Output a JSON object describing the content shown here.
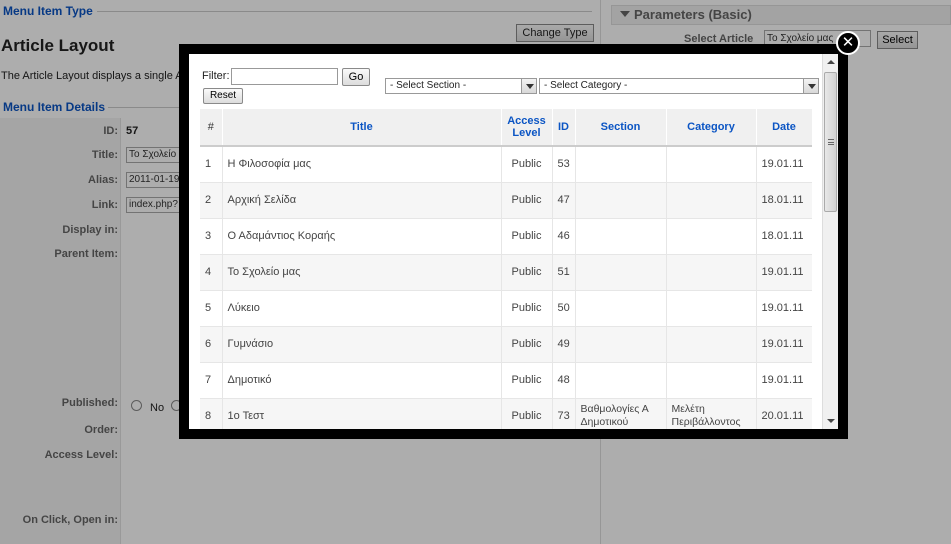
{
  "background": {
    "menu_item_type_legend": "Menu Item Type",
    "article_title": "Article Layout",
    "article_desc": "The Article Layout displays a single A",
    "change_type_button": "Change Type",
    "menu_item_details_legend": "Menu Item Details",
    "fields": {
      "id_label": "ID:",
      "id_value": "57",
      "title_label": "Title:",
      "title_value": "Το Σχολείο",
      "alias_label": "Alias:",
      "alias_value": "2011-01-19",
      "link_label": "Link:",
      "link_value": "index.php?",
      "display_in_label": "Display in:",
      "parent_item_label": "Parent Item:",
      "published_label": "Published:",
      "published_no": "No",
      "order_label": "Order:",
      "access_level_label": "Access Level:",
      "on_click_label": "On Click, Open in:"
    },
    "parameters_title": "Parameters (Basic)",
    "select_article_label": "Select Article",
    "select_article_value": "Το Σχολείο μας",
    "select_button": "Select"
  },
  "modal": {
    "close_glyph": "✕",
    "filter_label": "Filter:",
    "filter_value": "",
    "go_button": "Go",
    "reset_button": "Reset",
    "section_select": "- Select Section -",
    "category_select": "- Select Category -",
    "columns": {
      "num": "#",
      "title": "Title",
      "access_line1": "Access",
      "access_line2": "Level",
      "id": "ID",
      "section": "Section",
      "category": "Category",
      "date": "Date"
    },
    "rows": [
      {
        "num": "1",
        "title": "Η Φιλοσοφία μας",
        "access": "Public",
        "id": "53",
        "section": "",
        "category": "",
        "date": "19.01.11"
      },
      {
        "num": "2",
        "title": "Αρχική Σελίδα",
        "access": "Public",
        "id": "47",
        "section": "",
        "category": "",
        "date": "18.01.11"
      },
      {
        "num": "3",
        "title": "Ο Αδαμάντιος Κοραής",
        "access": "Public",
        "id": "46",
        "section": "",
        "category": "",
        "date": "18.01.11"
      },
      {
        "num": "4",
        "title": "Το Σχολείο μας",
        "access": "Public",
        "id": "51",
        "section": "",
        "category": "",
        "date": "19.01.11"
      },
      {
        "num": "5",
        "title": "Λύκειο",
        "access": "Public",
        "id": "50",
        "section": "",
        "category": "",
        "date": "19.01.11"
      },
      {
        "num": "6",
        "title": "Γυμνάσιο",
        "access": "Public",
        "id": "49",
        "section": "",
        "category": "",
        "date": "19.01.11"
      },
      {
        "num": "7",
        "title": "Δημοτικό",
        "access": "Public",
        "id": "48",
        "section": "",
        "category": "",
        "date": "19.01.11"
      },
      {
        "num": "8",
        "title": "1ο Τεστ",
        "access": "Public",
        "id": "73",
        "section": "Βαθμολογίες Α Δημοτικού",
        "category": "Μελέτη Περιβάλλοντος",
        "date": "20.01.11"
      }
    ]
  }
}
